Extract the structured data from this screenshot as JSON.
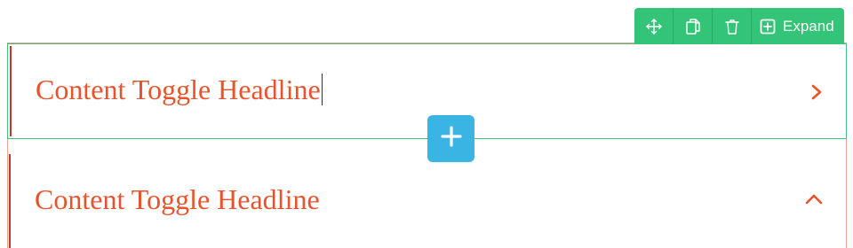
{
  "toolbar": {
    "move_icon": "move-arrows-icon",
    "duplicate_icon": "duplicate-icon",
    "delete_icon": "trash-icon",
    "expand_icon": "plus-square-icon",
    "expand_label": "Expand"
  },
  "toggles": [
    {
      "headline": "Content Toggle Headline",
      "state": "collapsed",
      "icon": "chevron-right-icon"
    },
    {
      "headline": "Content Toggle Headline",
      "state": "expanded",
      "icon": "chevron-up-icon"
    }
  ],
  "add_button": {
    "icon": "plus-icon"
  },
  "colors": {
    "toolbar": "#34c477",
    "headline": "#e8532b",
    "add_button": "#3ab4e2",
    "active_border": "#3cc47c"
  }
}
